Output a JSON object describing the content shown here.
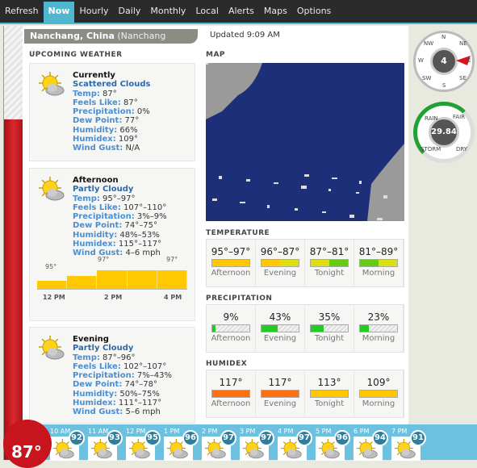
{
  "nav": {
    "tabs": [
      "Refresh",
      "Now",
      "Hourly",
      "Daily",
      "Monthly",
      "Local",
      "Alerts",
      "Maps",
      "Options"
    ],
    "active": "Now"
  },
  "current_temp": "87°",
  "location": {
    "city": "Nanchang, China",
    "station": "(Nanchang Airport)",
    "updated": "Updated 9:09 AM"
  },
  "upcoming": {
    "title": "UPCOMING WEATHER",
    "cards": [
      {
        "title": "Currently",
        "condition": "Scattered Clouds",
        "rows": [
          [
            "Temp:",
            "87°"
          ],
          [
            "Feels Like:",
            "87°"
          ],
          [
            "Precipitation:",
            "0%"
          ],
          [
            "Dew Point:",
            "77°"
          ],
          [
            "Humidity:",
            "66%"
          ],
          [
            "Humidex:",
            "109°"
          ],
          [
            "Wind Gust:",
            "N/A"
          ]
        ]
      },
      {
        "title": "Afternoon",
        "condition": "Partly Cloudy",
        "rows": [
          [
            "Temp:",
            "95°–97°"
          ],
          [
            "Feels Like:",
            "107°–110°"
          ],
          [
            "Precipitation:",
            "3%–9%"
          ],
          [
            "Dew Point:",
            "74°–75°"
          ],
          [
            "Humidity:",
            "48%–53%"
          ],
          [
            "Humidex:",
            "115°–117°"
          ],
          [
            "Wind Gust:",
            "4–6 mph"
          ]
        ],
        "chart": {
          "values": [
            95,
            96,
            97,
            97,
            97
          ],
          "labels": [
            "95°",
            "97°",
            "97°"
          ],
          "ticks": [
            "12 PM",
            "2 PM",
            "4 PM"
          ]
        }
      },
      {
        "title": "Evening",
        "condition": "Partly Cloudy",
        "rows": [
          [
            "Temp:",
            "87°–96°"
          ],
          [
            "Feels Like:",
            "102°–107°"
          ],
          [
            "Precipitation:",
            "7%–43%"
          ],
          [
            "Dew Point:",
            "74°–78°"
          ],
          [
            "Humidity:",
            "50%–75%"
          ],
          [
            "Humidex:",
            "111°–117°"
          ],
          [
            "Wind Gust:",
            "5–6 mph"
          ]
        ]
      }
    ]
  },
  "map": {
    "title": "MAP"
  },
  "periods": [
    "Afternoon",
    "Evening",
    "Tonight",
    "Morning"
  ],
  "temperature": {
    "title": "TEMPERATURE",
    "values": [
      "95°–97°",
      "96°–87°",
      "87°–81°",
      "81°–89°"
    ],
    "bars": [
      [
        "#ffc800",
        "#ffc800"
      ],
      [
        "#ffc800",
        "#dde010"
      ],
      [
        "#dde010",
        "#66cc11"
      ],
      [
        "#66cc11",
        "#dde010"
      ]
    ]
  },
  "precipitation": {
    "title": "PRECIPITATION",
    "values": [
      "9%",
      "43%",
      "35%",
      "23%"
    ],
    "percent": [
      9,
      43,
      35,
      23
    ],
    "color": "#22cc22"
  },
  "humidex": {
    "title": "HUMIDEX",
    "values": [
      "117°",
      "117°",
      "113°",
      "109°"
    ],
    "colors": [
      "#ff7010",
      "#ff7010",
      "#ffc800",
      "#ffc800"
    ]
  },
  "wind": {
    "speed": "4",
    "dirs": [
      "N",
      "NE",
      "E",
      "SE",
      "S",
      "SW",
      "W",
      "NW"
    ]
  },
  "pressure": {
    "value": "29.84",
    "labels": [
      "RAIN",
      "FAIR",
      "STORM",
      "DRY"
    ]
  },
  "hourly": [
    [
      "10 AM",
      "92"
    ],
    [
      "11 AM",
      "93"
    ],
    [
      "12 PM",
      "95"
    ],
    [
      "1 PM",
      "96"
    ],
    [
      "2 PM",
      "97"
    ],
    [
      "3 PM",
      "97"
    ],
    [
      "4 PM",
      "97"
    ],
    [
      "5 PM",
      "96"
    ],
    [
      "6 PM",
      "94"
    ],
    [
      "7 PM",
      "91"
    ]
  ]
}
